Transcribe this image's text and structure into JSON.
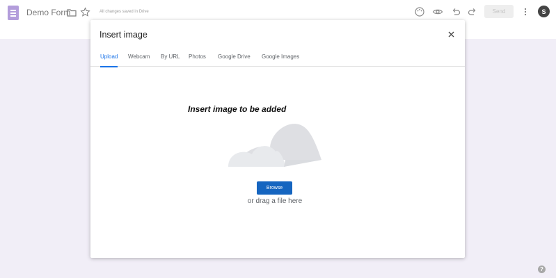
{
  "header": {
    "title": "Demo Form",
    "saved_status": "All changes saved in Drive",
    "send_label": "Send",
    "avatar_letter": "S",
    "icons": [
      "form-icon",
      "folder-icon",
      "star-icon",
      "palette-icon",
      "eye-icon",
      "undo-icon",
      "redo-icon",
      "more-vert-icon"
    ]
  },
  "dialog": {
    "title": "Insert image",
    "tabs": [
      "Upload",
      "Webcam",
      "By URL",
      "Photos",
      "Google Drive",
      "Google Images"
    ],
    "active_tab": "Upload",
    "caption": "Insert image to be added",
    "browse_label": "Browse",
    "drag_text": "or drag a file here"
  },
  "colors": {
    "accent": "#1a73e8",
    "browse_button": "#1565c0",
    "background": "#f1eef7",
    "form_icon": "#b39ddb"
  },
  "help": {
    "icon": "help-icon",
    "symbol": "?"
  }
}
